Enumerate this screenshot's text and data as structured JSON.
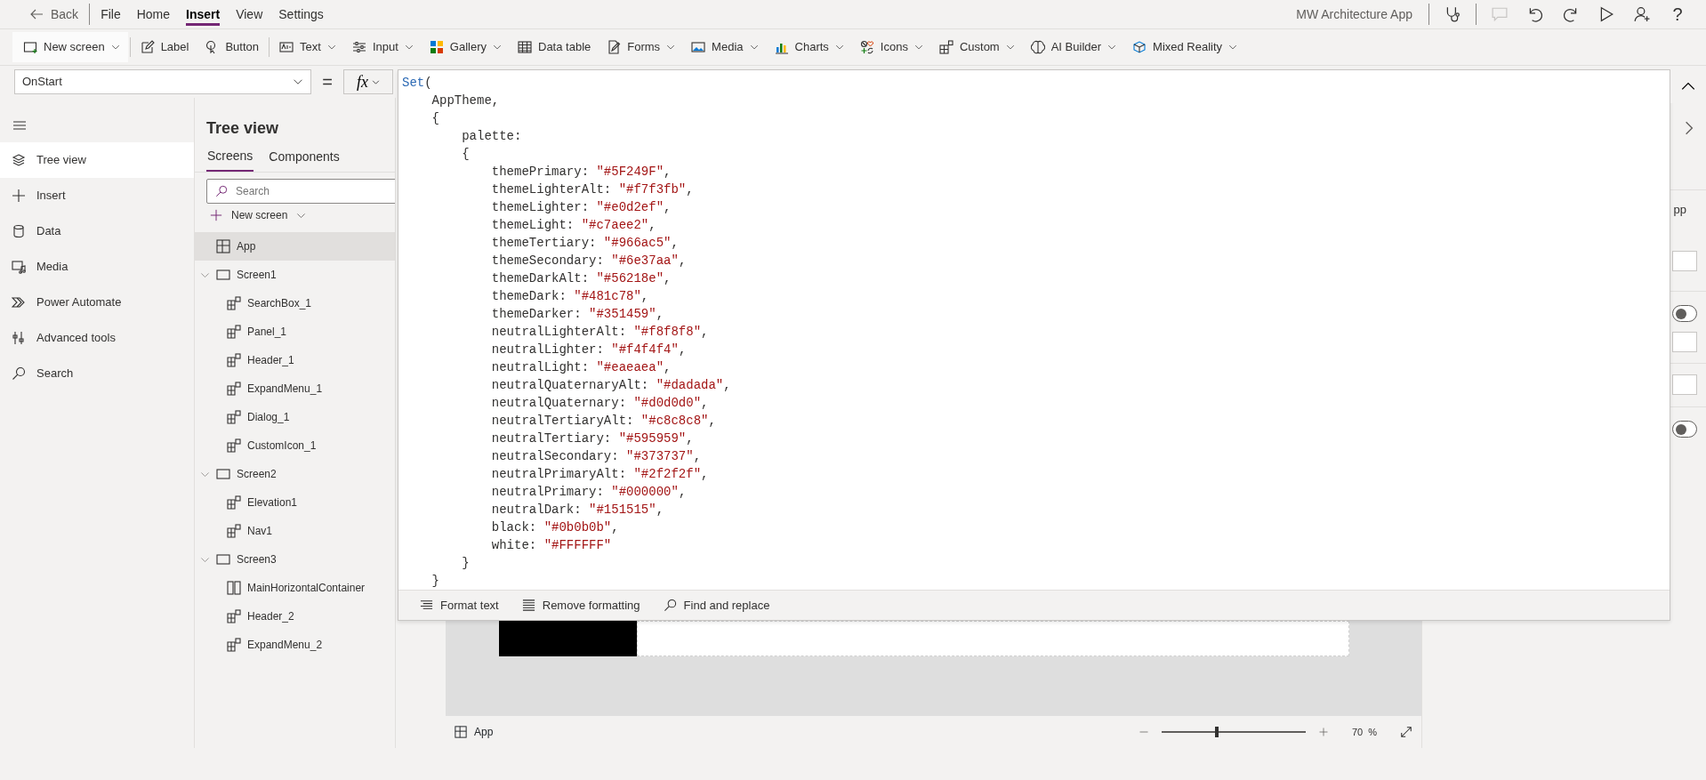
{
  "app_bar": {
    "back": "Back",
    "menu": [
      {
        "label": "File",
        "selected": false
      },
      {
        "label": "Home",
        "selected": false
      },
      {
        "label": "Insert",
        "selected": true
      },
      {
        "label": "View",
        "selected": false
      },
      {
        "label": "Settings",
        "selected": false
      }
    ],
    "app_name": "MW Architecture App",
    "actions": [
      {
        "kind": "stethoscope",
        "disabled": false
      },
      {
        "kind": "comment",
        "disabled": true
      },
      {
        "kind": "undo",
        "disabled": false
      },
      {
        "kind": "redo",
        "disabled": false
      },
      {
        "kind": "play",
        "disabled": false
      },
      {
        "kind": "person",
        "disabled": false
      },
      {
        "kind": "help",
        "text": "?",
        "disabled": false
      }
    ]
  },
  "ribbon": [
    {
      "label": "New screen",
      "kind": "screen",
      "dropdown": true,
      "separator": true
    },
    {
      "label": "Label",
      "kind": "label",
      "dropdown": false,
      "separator": false
    },
    {
      "label": "Button",
      "kind": "button",
      "dropdown": false,
      "separator": true
    },
    {
      "label": "Text",
      "kind": "text",
      "dropdown": true,
      "separator": false
    },
    {
      "label": "Input",
      "kind": "input",
      "dropdown": true,
      "separator": false
    },
    {
      "label": "Gallery",
      "kind": "gallery",
      "dropdown": true,
      "separator": false
    },
    {
      "label": "Data table",
      "kind": "table",
      "dropdown": false,
      "separator": false
    },
    {
      "label": "Forms",
      "kind": "forms",
      "dropdown": true,
      "separator": false
    },
    {
      "label": "Media",
      "kind": "media",
      "dropdown": true,
      "separator": false
    },
    {
      "label": "Charts",
      "kind": "charts",
      "dropdown": true,
      "separator": false
    },
    {
      "label": "Icons",
      "kind": "icons",
      "dropdown": true,
      "separator": false
    },
    {
      "label": "Custom",
      "kind": "custom",
      "dropdown": true,
      "separator": false
    },
    {
      "label": "AI Builder",
      "kind": "ai",
      "dropdown": true,
      "separator": false
    },
    {
      "label": "Mixed Reality",
      "kind": "mixed",
      "dropdown": true,
      "separator": false
    }
  ],
  "formula_bar": {
    "property": "OnStart",
    "equals": "=",
    "fx": "fx",
    "lines": [
      {
        "keyword": "Set",
        "code": "("
      },
      {
        "code": "    AppTheme,"
      },
      {
        "code": "    {"
      },
      {
        "code": "        palette:"
      },
      {
        "code": "        {"
      },
      {
        "code": "            themePrimary: ",
        "string": "\"#5F249F\"",
        "rest": ","
      },
      {
        "code": "            themeLighterAlt: ",
        "string": "\"#f7f3fb\"",
        "rest": ","
      },
      {
        "code": "            themeLighter: ",
        "string": "\"#e0d2ef\"",
        "rest": ","
      },
      {
        "code": "            themeLight: ",
        "string": "\"#c7aee2\"",
        "rest": ","
      },
      {
        "code": "            themeTertiary: ",
        "string": "\"#966ac5\"",
        "rest": ","
      },
      {
        "code": "            themeSecondary: ",
        "string": "\"#6e37aa\"",
        "rest": ","
      },
      {
        "code": "            themeDarkAlt: ",
        "string": "\"#56218e\"",
        "rest": ","
      },
      {
        "code": "            themeDark: ",
        "string": "\"#481c78\"",
        "rest": ","
      },
      {
        "code": "            themeDarker: ",
        "string": "\"#351459\"",
        "rest": ","
      },
      {
        "code": "            neutralLighterAlt: ",
        "string": "\"#f8f8f8\"",
        "rest": ","
      },
      {
        "code": "            neutralLighter: ",
        "string": "\"#f4f4f4\"",
        "rest": ","
      },
      {
        "code": "            neutralLight: ",
        "string": "\"#eaeaea\"",
        "rest": ","
      },
      {
        "code": "            neutralQuaternaryAlt: ",
        "string": "\"#dadada\"",
        "rest": ","
      },
      {
        "code": "            neutralQuaternary: ",
        "string": "\"#d0d0d0\"",
        "rest": ","
      },
      {
        "code": "            neutralTertiaryAlt: ",
        "string": "\"#c8c8c8\"",
        "rest": ","
      },
      {
        "code": "            neutralTertiary: ",
        "string": "\"#595959\"",
        "rest": ","
      },
      {
        "code": "            neutralSecondary: ",
        "string": "\"#373737\"",
        "rest": ","
      },
      {
        "code": "            neutralPrimaryAlt: ",
        "string": "\"#2f2f2f\"",
        "rest": ","
      },
      {
        "code": "            neutralPrimary: ",
        "string": "\"#000000\"",
        "rest": ","
      },
      {
        "code": "            neutralDark: ",
        "string": "\"#151515\"",
        "rest": ","
      },
      {
        "code": "            black: ",
        "string": "\"#0b0b0b\"",
        "rest": ","
      },
      {
        "code": "            white: ",
        "string": "\"#FFFFFF\""
      },
      {
        "code": "        }"
      },
      {
        "code": "    }"
      }
    ],
    "toolbar": [
      {
        "label": "Format text",
        "kind": "format"
      },
      {
        "label": "Remove formatting",
        "kind": "lines"
      },
      {
        "label": "Find and replace",
        "kind": "search"
      }
    ]
  },
  "nav": [
    {
      "label": "Tree view",
      "kind": "layers",
      "selected": true
    },
    {
      "label": "Insert",
      "kind": "plus",
      "selected": false
    },
    {
      "label": "Data",
      "kind": "data",
      "selected": false
    },
    {
      "label": "Media",
      "kind": "media",
      "selected": false
    },
    {
      "label": "Power Automate",
      "kind": "automate",
      "selected": false
    },
    {
      "label": "Advanced tools",
      "kind": "tools",
      "selected": false
    },
    {
      "label": "Search",
      "kind": "search",
      "selected": false
    }
  ],
  "tree_view": {
    "title": "Tree view",
    "tabs": [
      {
        "label": "Screens",
        "selected": true
      },
      {
        "label": "Components",
        "selected": false
      }
    ],
    "search": {
      "placeholder": "Search"
    },
    "new_screen": "New screen",
    "items": [
      {
        "label": "App",
        "kind": "app",
        "selected": true
      },
      {
        "label": "Screen1",
        "kind": "screen",
        "selected": false,
        "expanded": true,
        "children": [
          {
            "label": "SearchBox_1",
            "kind": "component",
            "selected": false
          },
          {
            "label": "Panel_1",
            "kind": "component",
            "selected": false
          },
          {
            "label": "Header_1",
            "kind": "component",
            "selected": false
          },
          {
            "label": "ExpandMenu_1",
            "kind": "component",
            "selected": false
          },
          {
            "label": "Dialog_1",
            "kind": "component",
            "selected": false
          },
          {
            "label": "CustomIcon_1",
            "kind": "component",
            "selected": false
          }
        ]
      },
      {
        "label": "Screen2",
        "kind": "screen",
        "selected": false,
        "expanded": true,
        "children": [
          {
            "label": "Elevation1",
            "kind": "component",
            "selected": false
          },
          {
            "label": "Nav1",
            "kind": "component",
            "selected": false
          }
        ]
      },
      {
        "label": "Screen3",
        "kind": "screen",
        "selected": false,
        "expanded": true,
        "children": [
          {
            "label": "MainHorizontalContainer",
            "kind": "container",
            "selected": false
          },
          {
            "label": "Header_2",
            "kind": "component",
            "selected": false
          },
          {
            "label": "ExpandMenu_2",
            "kind": "component",
            "selected": false
          }
        ]
      }
    ]
  },
  "properties_panel": {
    "label": "pp",
    "toggles": [
      {
        "on": false
      },
      {
        "on": false
      }
    ]
  },
  "status_bar": {
    "screen": "App",
    "level": 0.38,
    "zoom": "70",
    "unit": "%"
  }
}
